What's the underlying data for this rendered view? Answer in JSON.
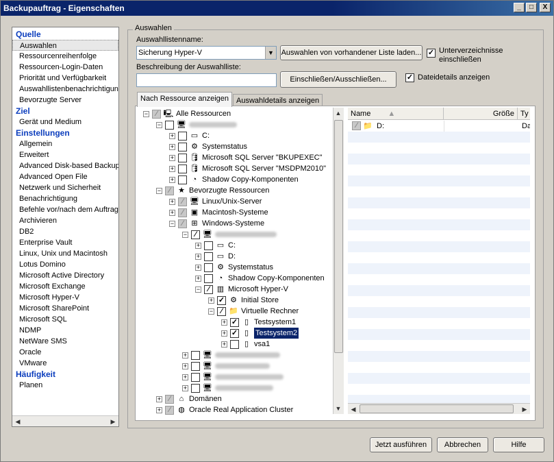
{
  "window": {
    "title": "Backupauftrag - Eigenschaften",
    "btn_min": "_",
    "btn_max": "□",
    "btn_close": "X"
  },
  "nav": {
    "sections": [
      {
        "heading": "Quelle",
        "items": [
          "Auswahlen",
          "Ressourcenreihenfolge",
          "Ressourcen-Login-Daten",
          "Priorität und Verfügbarkeit",
          "Auswahllistenbenachrichtigung",
          "Bevorzugte Server"
        ]
      },
      {
        "heading": "Ziel",
        "items": [
          "Gerät und Medium"
        ]
      },
      {
        "heading": "Einstellungen",
        "items": [
          "Allgemein",
          "Erweitert",
          "Advanced Disk-based Backup",
          "Advanced Open File",
          "Netzwerk und Sicherheit",
          "Benachrichtigung",
          "Befehle vor/nach dem Auftrag",
          "Archivieren",
          "DB2",
          "Enterprise Vault",
          "Linux, Unix und Macintosh",
          "Lotus Domino",
          "Microsoft Active Directory",
          "Microsoft Exchange",
          "Microsoft Hyper-V",
          "Microsoft SharePoint",
          "Microsoft SQL",
          "NDMP",
          "NetWare SMS",
          "Oracle",
          "VMware"
        ]
      },
      {
        "heading": "Häufigkeit",
        "items": [
          "Planen"
        ]
      }
    ]
  },
  "selection": {
    "group_title": "Auswahlen",
    "list_name_label": "Auswahllistenname:",
    "list_name_value": "Sicherung Hyper-V",
    "load_button": "Auswahlen von vorhandener Liste laden...",
    "include_subdirs_label": "Unterverzeichnisse einschließen",
    "include_subdirs_checked": true,
    "description_label": "Beschreibung der Auswahlliste:",
    "description_value": "",
    "include_exclude_button": "Einschließen/Ausschließen...",
    "file_details_label": "Dateidetails anzeigen",
    "file_details_checked": true
  },
  "tabs": [
    "Nach Ressource anzeigen",
    "Auswahldetails anzeigen"
  ],
  "tree": {
    "all_resources": "Alle Ressourcen",
    "c_drive": "C:",
    "systemstatus": "Systemstatus",
    "sql_bkupexec": "Microsoft SQL Server \"BKUPEXEC\"",
    "sql_msdpm": "Microsoft SQL Server \"MSDPM2010\"",
    "shadow_copy": "Shadow Copy-Komponenten",
    "preferred": "Bevorzugte Ressourcen",
    "linux": "Linux/Unix-Server",
    "mac": "Macintosh-Systeme",
    "windows": "Windows-Systeme",
    "c_drive2": "C:",
    "d_drive": "D:",
    "systemstatus2": "Systemstatus",
    "shadow_copy2": "Shadow Copy-Komponenten",
    "hyperv": "Microsoft Hyper-V",
    "initial_store": "Initial Store",
    "virtual_machines": "Virtuelle Rechner",
    "vm1": "Testsystem1",
    "vm2": "Testsystem2",
    "vm3": "vsa1",
    "domains": "Domänen",
    "oracle_rac": "Oracle Real Application Cluster"
  },
  "list": {
    "col_name": "Name",
    "col_size": "Größe",
    "col_type": "Ty",
    "rows": [
      {
        "name": "D:",
        "type": "Da"
      }
    ]
  },
  "footer": {
    "run_now": "Jetzt ausführen",
    "cancel": "Abbrechen",
    "help": "Hilfe"
  },
  "icons": {
    "expand": "+",
    "collapse": "−",
    "check": "✓",
    "partial": "⁄"
  },
  "colors": {
    "title_bar": "#0a246a",
    "nav_heading": "#0b3dbd",
    "selection": "#0a246a"
  }
}
